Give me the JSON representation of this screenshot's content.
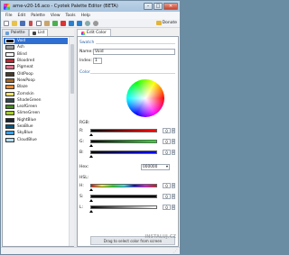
{
  "window": {
    "title": "arne-v20-16.aco - Cyotek Palette Editor (BETA)",
    "btn_min": "–",
    "btn_max": "□",
    "btn_close": "✕"
  },
  "menu": [
    "File",
    "Edit",
    "Palette",
    "View",
    "Tools",
    "Help"
  ],
  "toolbar": {
    "donate_label": "Donate"
  },
  "left_tabs": [
    {
      "label": "Palette"
    },
    {
      "label": "List"
    }
  ],
  "colors": [
    {
      "name": "Void",
      "hex": "#000000",
      "selected": true
    },
    {
      "name": "Ash",
      "hex": "#9d9d9d"
    },
    {
      "name": "Blind",
      "hex": "#ffffff"
    },
    {
      "name": "Bloodred",
      "hex": "#be2633"
    },
    {
      "name": "Pigmeat",
      "hex": "#e06f8b"
    },
    {
      "name": "OldPoop",
      "hex": "#493c2b"
    },
    {
      "name": "NewPoop",
      "hex": "#a46422"
    },
    {
      "name": "Blaze",
      "hex": "#eb8931"
    },
    {
      "name": "Zornskin",
      "hex": "#f7e26b"
    },
    {
      "name": "ShadeGreen",
      "hex": "#2f484e"
    },
    {
      "name": "LeafGreen",
      "hex": "#44891a"
    },
    {
      "name": "SlimeGreen",
      "hex": "#a3ce27"
    },
    {
      "name": "NightBlue",
      "hex": "#1b2632"
    },
    {
      "name": "SeaBlue",
      "hex": "#005784"
    },
    {
      "name": "SkyBlue",
      "hex": "#31a2f2"
    },
    {
      "name": "CloudBlue",
      "hex": "#b2dcef"
    }
  ],
  "editor": {
    "tab_label": "Edit Color",
    "swatch_header": "Swatch",
    "name_label": "Name:",
    "name_value": "Void",
    "index_label": "Index:",
    "index_value": "1",
    "color_header": "Color",
    "rgb_label": "RGB:",
    "r_label": "R:",
    "g_label": "G:",
    "b_label": "B:",
    "r_value": "0",
    "g_value": "0",
    "b_value": "0",
    "hex_label": "Hex:",
    "hex_value": "000000",
    "hsl_label": "HSL:",
    "h_label": "H:",
    "s_label": "S:",
    "l_label": "L:",
    "h_value": "0",
    "s_value": "0",
    "l_value": "0",
    "drag_hint": "Drag to select color from screen"
  },
  "watermark": "INSTALUJ.CZ"
}
